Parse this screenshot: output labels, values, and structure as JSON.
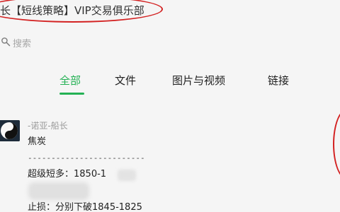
{
  "window": {
    "title": "长【短线策略】VIP交易俱乐部"
  },
  "search": {
    "placeholder": "搜索"
  },
  "tabs": [
    {
      "label": "全部",
      "active": true
    },
    {
      "label": "文件",
      "active": false
    },
    {
      "label": "图片与视频",
      "active": false
    },
    {
      "label": "链接",
      "active": false
    }
  ],
  "message": {
    "sender": "-诺亚-船长",
    "lines": [
      "焦炭",
      "-------------------------",
      "超级短多：1850-1",
      "",
      "止损：分别下破1845-1825"
    ]
  },
  "colors": {
    "accent_green": "#24b154",
    "highlight_red": "#d32222",
    "background": "#f5f5f5"
  },
  "icons": {
    "search": "search-icon",
    "avatar": "yin-yang-avatar-icon"
  }
}
